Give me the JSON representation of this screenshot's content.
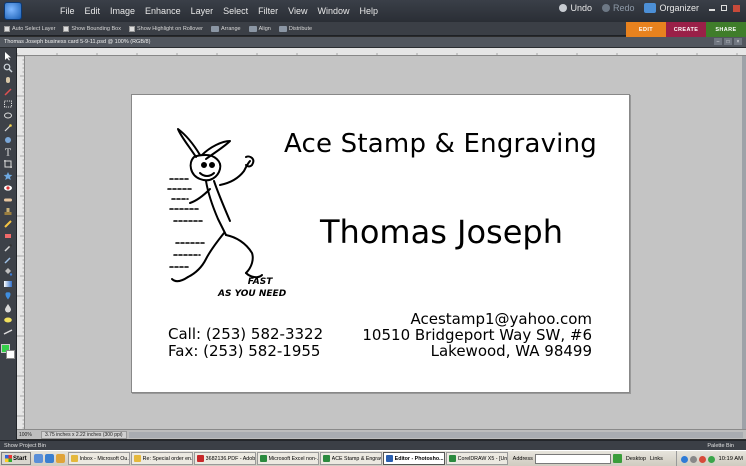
{
  "window": {
    "menus": [
      "File",
      "Edit",
      "Image",
      "Enhance",
      "Layer",
      "Select",
      "Filter",
      "View",
      "Window",
      "Help"
    ],
    "undo_label": "Undo",
    "redo_label": "Redo",
    "organizer_label": "Organizer"
  },
  "options_bar": {
    "auto_select_layer": "Auto Select Layer",
    "show_bounding_box": "Show Bounding Box",
    "show_highlight": "Show Highlight on Rollover",
    "arrange": "Arrange",
    "align": "Align",
    "distribute": "Distribute"
  },
  "mode_tabs": {
    "edit": "EDIT",
    "create": "CREATE",
    "share": "SHARE",
    "colors": {
      "edit": "#e8821e",
      "create": "#9a2048",
      "share": "#3f7d2a"
    }
  },
  "document": {
    "title": "Thomas Joseph business card 5-9-11.psd @ 100% (RGB/8)"
  },
  "colors": {
    "foreground": "#35d04a",
    "background": "#ffffff"
  },
  "card": {
    "company": "Ace Stamp & Engraving",
    "name": "Thomas Joseph",
    "slogan_line1": "FAST",
    "slogan_line2": "AS YOU NEED",
    "phone": "Call: (253) 582-3322",
    "fax": "Fax: (253) 582-1955",
    "email": "Acestamp1@yahoo.com",
    "address_line1": "10510 Bridgeport Way SW, #6",
    "address_line2": "Lakewood, WA 98499"
  },
  "status_bar": {
    "zoom": "100%",
    "doc_size": "3.75 inches x 2.22 inches (300 ppi)"
  },
  "bins": {
    "project_bin": "Show Project Bin",
    "palette_bin": "Palette Bin"
  },
  "taskbar": {
    "start": "Start",
    "tasks": [
      {
        "label": "Inbox - Microsoft Ou...",
        "color": "#e5b83c"
      },
      {
        "label": "Re: Special order en...",
        "color": "#e5b83c"
      },
      {
        "label": "3682136.PDF - Adob...",
        "color": "#c8282a"
      },
      {
        "label": "Microsoft Excel non-...",
        "color": "#2b8a3e"
      },
      {
        "label": "ACE Stamp & Engrav...",
        "color": "#2b8a3e"
      },
      {
        "label": "Editor - Photosho...",
        "color": "#2a5fb0"
      },
      {
        "label": "CorelDRAW X5 - [Un...",
        "color": "#2b8a3e"
      }
    ],
    "address_label": "Address",
    "desktop_label": "Desktop",
    "links_label": "Links",
    "clock": "10:19 AM"
  }
}
